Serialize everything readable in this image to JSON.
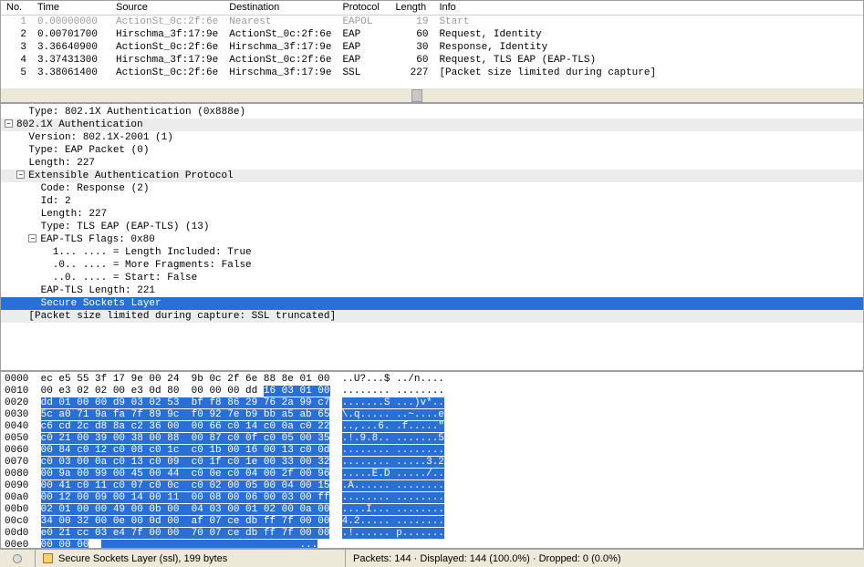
{
  "columns": [
    "No.",
    "Time",
    "Source",
    "Destination",
    "Protocol",
    "Length",
    "Info"
  ],
  "packets": [
    {
      "no": "1",
      "time": "0.00000000",
      "src": "ActionSt_0c:2f:6e",
      "dst": "Nearest",
      "proto": "EAPOL",
      "len": "19",
      "info": "Start",
      "dim": true
    },
    {
      "no": "2",
      "time": "0.00701700",
      "src": "Hirschma_3f:17:9e",
      "dst": "ActionSt_0c:2f:6e",
      "proto": "EAP",
      "len": "60",
      "info": "Request, Identity"
    },
    {
      "no": "3",
      "time": "3.36640900",
      "src": "ActionSt_0c:2f:6e",
      "dst": "Hirschma_3f:17:9e",
      "proto": "EAP",
      "len": "30",
      "info": "Response, Identity"
    },
    {
      "no": "4",
      "time": "3.37431300",
      "src": "Hirschma_3f:17:9e",
      "dst": "ActionSt_0c:2f:6e",
      "proto": "EAP",
      "len": "60",
      "info": "Request, TLS EAP (EAP-TLS)"
    },
    {
      "no": "5",
      "time": "3.38061400",
      "src": "ActionSt_0c:2f:6e",
      "dst": "Hirschma_3f:17:9e",
      "proto": "SSL",
      "len": "227",
      "info": "[Packet size limited during capture]"
    }
  ],
  "detail": {
    "l0": "    Type: 802.1X Authentication (0x888e)",
    "l1": "802.1X Authentication",
    "l2": "    Version: 802.1X-2001 (1)",
    "l3": "    Type: EAP Packet (0)",
    "l4": "    Length: 227",
    "l5": "Extensible Authentication Protocol",
    "l6": "      Code: Response (2)",
    "l7": "      Id: 2",
    "l8": "      Length: 227",
    "l9": "      Type: TLS EAP (EAP-TLS) (13)",
    "l10": "EAP-TLS Flags: 0x80",
    "l11": "        1... .... = Length Included: True",
    "l12": "        .0.. .... = More Fragments: False",
    "l13": "        ..0. .... = Start: False",
    "l14": "      EAP-TLS Length: 221",
    "l15": "      Secure Sockets Layer",
    "l16": "    [Packet size limited during capture: SSL truncated]"
  },
  "hex": [
    {
      "o": "0000",
      "a": "ec e5 55 3f 17 9e 00 24 ",
      "b": " 9b 0c 2f 6e 88 8e 01 00",
      "s0": 0,
      "t": "  ..U?...$ ../n...."
    },
    {
      "o": "0010",
      "a": "00 e3 02 02 00 e3 0d 80 ",
      "b": " 00 00 00 dd ",
      "c": "16 03 01 00",
      "t": "  ........ ........",
      "ts": 31
    },
    {
      "o": "0020",
      "a": "",
      "c": "dd 01 00 00 d9 03 02 53  bf f8 86 29 76 2a 99 c7",
      "t": "  .......S ...)v*..",
      "ts": 2
    },
    {
      "o": "0030",
      "a": "",
      "c": "5c a0 71 9a fa 7f 89 9c  f0 92 7e b9 bb a5 ab 65",
      "t": "  \\.q..... ..~....e",
      "ts": 2
    },
    {
      "o": "0040",
      "a": "",
      "c": "c6 cd 2c d8 8a c2 36 00  00 66 c0 14 c0 0a c0 22",
      "t": "  ..,...6. .f.....\"",
      "ts": 2
    },
    {
      "o": "0050",
      "a": "",
      "c": "c0 21 00 39 00 38 00 88  00 87 c0 0f c0 05 00 35",
      "t": "  .!.9.8.. .......5",
      "ts": 2
    },
    {
      "o": "0060",
      "a": "",
      "c": "00 84 c0 12 c0 08 c0 1c  c0 1b 00 16 00 13 c0 0d",
      "t": "  ........ ........",
      "ts": 2
    },
    {
      "o": "0070",
      "a": "",
      "c": "c0 03 00 0a c0 13 c0 09  c0 1f c0 1e 00 33 00 32",
      "t": "  ........ .....3.2",
      "ts": 2
    },
    {
      "o": "0080",
      "a": "",
      "c": "00 9a 00 99 00 45 00 44  c0 0e c0 04 00 2f 00 96",
      "t": "  .....E.D ...../..",
      "ts": 2
    },
    {
      "o": "0090",
      "a": "",
      "c": "00 41 c0 11 c0 07 c0 0c  c0 02 00 05 00 04 00 15",
      "t": "  .A...... ........",
      "ts": 2
    },
    {
      "o": "00a0",
      "a": "",
      "c": "00 12 00 09 00 14 00 11  00 08 00 06 00 03 00 ff",
      "t": "  ........ ........",
      "ts": 2
    },
    {
      "o": "00b0",
      "a": "",
      "c": "02 01 00 00 49 00 0b 00  04 03 00 01 02 00 0a 00",
      "t": "  ....I... ........",
      "ts": 2
    },
    {
      "o": "00c0",
      "a": "",
      "c": "34 00 32 00 0e 00 0d 00  af 07 ce db ff 7f 00 00",
      "t": "  4.2..... ........",
      "ts": 2
    },
    {
      "o": "00d0",
      "a": "",
      "c": "e0 21 cc 03 e4 7f 00 00  70 07 ce db ff 7f 00 00",
      "t": "  .!...... p.......",
      "ts": 2
    },
    {
      "o": "00e0",
      "a": "",
      "c": "00 00 00",
      "t": "                                   ...",
      "ts": 2
    }
  ],
  "status": {
    "field": "Secure Sockets Layer (ssl), 199 bytes",
    "counts": "Packets: 144 · Displayed: 144 (100.0%) · Dropped: 0 (0.0%)"
  }
}
